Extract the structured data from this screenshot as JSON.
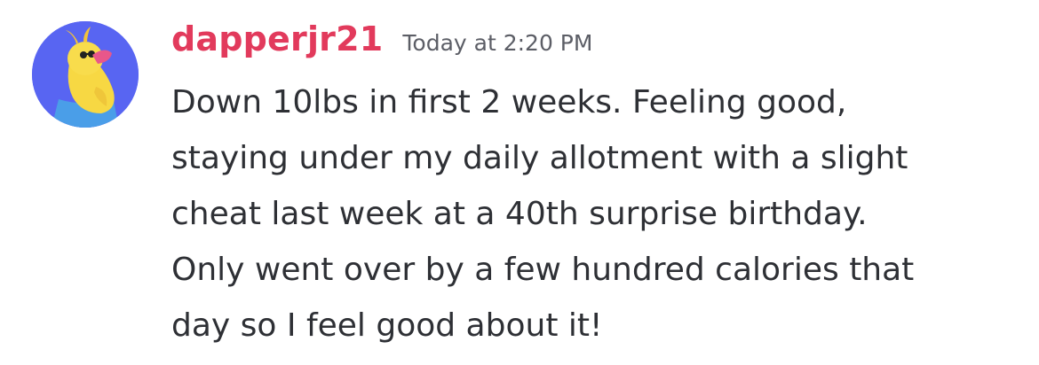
{
  "message": {
    "author": "dapperjr21",
    "timestamp": "Today at 2:20 PM",
    "avatar_icon": "yellow-duck-avatar-icon",
    "content_lines": [
      "Down 10lbs in first 2 weeks. Feeling good,",
      "staying under my daily allotment with a slight",
      "cheat last week at a 40th surprise birthday.",
      "Only went over by a few hundred calories that",
      "day so I feel good about it!"
    ]
  },
  "colors": {
    "username": "#e23a5c",
    "avatar_background": "#5865f2",
    "text": "#2e3035",
    "timestamp": "#5c5e66"
  }
}
